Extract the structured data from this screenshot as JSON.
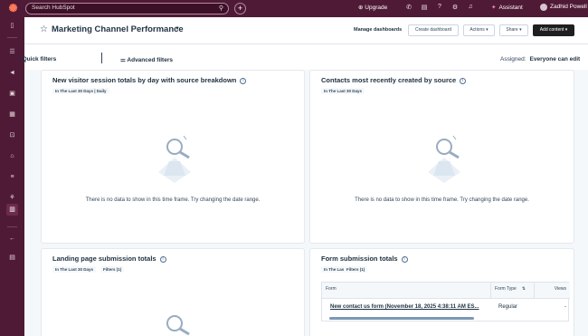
{
  "topbar": {
    "search_placeholder": "Search HubSpot",
    "upgrade_label": "Upgrade",
    "assistant_label": "Assistant",
    "user_name": "Zadhid Powell"
  },
  "header": {
    "title": "Marketing Channel Performance",
    "manage_label": "Manage dashboards",
    "create_label": "Create dashboard",
    "actions_label": "Actions ▾",
    "share_label": "Share ▾",
    "add_content_label": "Add content ▾"
  },
  "filters": {
    "quick_label": "Quick filters",
    "advanced_label": "Advanced filters",
    "assigned_label": "Assigned:",
    "assigned_value": "Everyone can edit"
  },
  "cards": [
    {
      "title": "New visitor session totals by day with source breakdown",
      "tags": [
        "In The Last 30 Days | Daily"
      ],
      "empty_text": "There is no data to show in this time frame. Try changing the date range."
    },
    {
      "title": "Contacts most recently created by source",
      "tags": [
        "In The Last 30 Days"
      ],
      "empty_text": "There is no data to show in this time frame. Try changing the date range."
    },
    {
      "title": "Landing page submission totals",
      "tags": [
        "In The Last 30 Days",
        "Filters (1)"
      ]
    },
    {
      "title": "Form submission totals",
      "tags": [
        "In The Last 30 Days",
        "Filters (1)"
      ],
      "table": {
        "columns": [
          "Form",
          "Form Type",
          "Views"
        ],
        "rows": [
          {
            "form": "New contact us form (November 18, 2025 4:38:11 AM ES...",
            "type": "Regular",
            "views": "-"
          }
        ]
      }
    }
  ]
}
